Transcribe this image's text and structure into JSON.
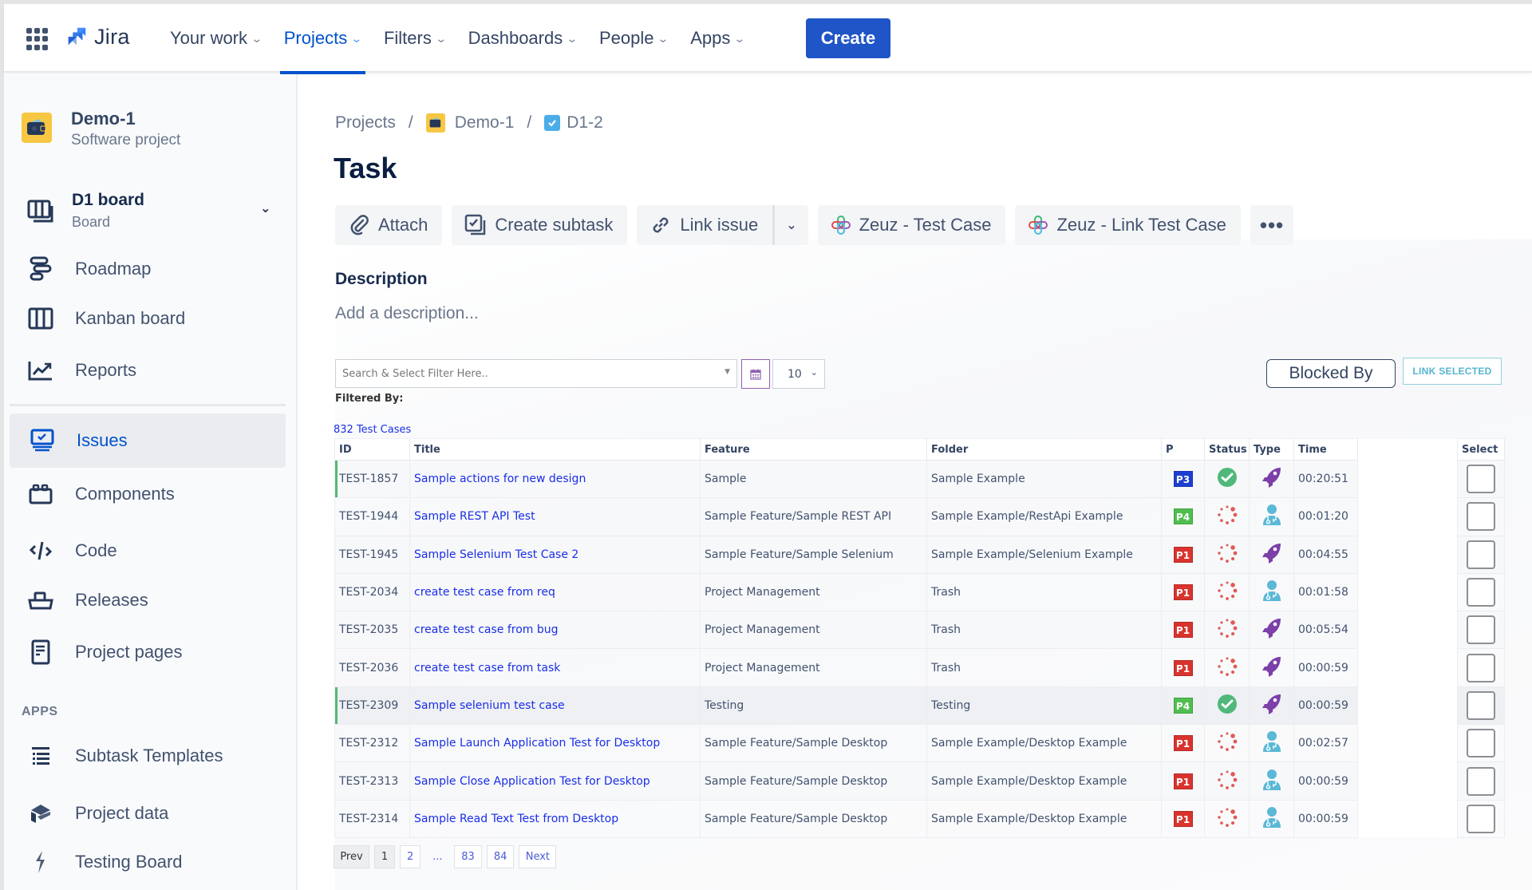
{
  "header": {
    "app_name": "Jira",
    "nav": [
      {
        "label": "Your work",
        "active": false
      },
      {
        "label": "Projects",
        "active": true
      },
      {
        "label": "Filters",
        "active": false
      },
      {
        "label": "Dashboards",
        "active": false
      },
      {
        "label": "People",
        "active": false
      },
      {
        "label": "Apps",
        "active": false
      }
    ],
    "create_label": "Create",
    "accent_color": "#0052cc"
  },
  "sidebar": {
    "project_name": "Demo-1",
    "project_type": "Software project",
    "board": {
      "label": "D1 board",
      "sub": "Board"
    },
    "items": [
      {
        "label": "Roadmap",
        "icon": "roadmap-icon"
      },
      {
        "label": "Kanban board",
        "icon": "kanban-icon"
      },
      {
        "label": "Reports",
        "icon": "reports-icon"
      },
      {
        "label": "Issues",
        "icon": "issues-icon",
        "active": true
      },
      {
        "label": "Components",
        "icon": "components-icon"
      },
      {
        "label": "Code",
        "icon": "code-icon"
      },
      {
        "label": "Releases",
        "icon": "releases-icon"
      },
      {
        "label": "Project pages",
        "icon": "project-pages-icon"
      }
    ],
    "apps_heading": "APPS",
    "apps": [
      {
        "label": "Subtask Templates",
        "icon": "list-icon"
      },
      {
        "label": "Project data",
        "icon": "project-data-icon"
      },
      {
        "label": "Testing Board",
        "icon": "lightning-icon"
      }
    ]
  },
  "breadcrumb": {
    "items": [
      "Projects",
      "Demo-1",
      "D1-2"
    ],
    "separator": "/"
  },
  "issue": {
    "type_title": "Task",
    "toolbar": {
      "attach": "Attach",
      "create_subtask": "Create subtask",
      "link_issue": "Link issue",
      "zeuz_test_case": "Zeuz - Test Case",
      "zeuz_link_test_case": "Zeuz - Link Test Case",
      "more": "•••"
    },
    "description_label": "Description",
    "description_placeholder": "Add a description..."
  },
  "test_cases": {
    "filter_placeholder": "Search & Select Filter Here..",
    "page_size": "10",
    "filtered_by_label": "Filtered By:",
    "count_label": "832 Test Cases",
    "blocked_by_label": "Blocked By",
    "link_selected_label": "LINK SELECTED",
    "columns": [
      "ID",
      "Title",
      "Feature",
      "Folder",
      "P",
      "Status",
      "Type",
      "Time",
      "Select"
    ],
    "rows": [
      {
        "id": "TEST-1857",
        "title": "Sample actions for new design",
        "feature": "Sample",
        "folder": "Sample Example",
        "priority": "P3",
        "status": "passed",
        "type": "automated",
        "time": "00:20:51",
        "marked": true
      },
      {
        "id": "TEST-1944",
        "title": "Sample REST API Test",
        "feature": "Sample Feature/Sample REST API",
        "folder": "Sample Example/RestApi Example",
        "priority": "P4",
        "status": "in-progress",
        "type": "manual",
        "time": "00:01:20"
      },
      {
        "id": "TEST-1945",
        "title": "Sample Selenium Test Case 2",
        "feature": "Sample Feature/Sample Selenium",
        "folder": "Sample Example/Selenium Example",
        "priority": "P1",
        "status": "in-progress",
        "type": "automated",
        "time": "00:04:55"
      },
      {
        "id": "TEST-2034",
        "title": "create test case from req",
        "feature": "Project Management",
        "folder": "Trash",
        "priority": "P1",
        "status": "in-progress",
        "type": "manual",
        "time": "00:01:58"
      },
      {
        "id": "TEST-2035",
        "title": "create test case from bug",
        "feature": "Project Management",
        "folder": "Trash",
        "priority": "P1",
        "status": "in-progress",
        "type": "automated",
        "time": "00:05:54"
      },
      {
        "id": "TEST-2036",
        "title": "create test case from task",
        "feature": "Project Management",
        "folder": "Trash",
        "priority": "P1",
        "status": "in-progress",
        "type": "automated",
        "time": "00:00:59"
      },
      {
        "id": "TEST-2309",
        "title": "Sample selenium test case",
        "feature": "Testing",
        "folder": "Testing",
        "priority": "P4",
        "status": "passed",
        "type": "automated",
        "time": "00:00:59",
        "marked": true,
        "highlight": true
      },
      {
        "id": "TEST-2312",
        "title": "Sample Launch Application Test for Desktop",
        "feature": "Sample Feature/Sample Desktop",
        "folder": "Sample Example/Desktop Example",
        "priority": "P1",
        "status": "in-progress",
        "type": "manual",
        "time": "00:02:57"
      },
      {
        "id": "TEST-2313",
        "title": "Sample Close Application Test for Desktop",
        "feature": "Sample Feature/Sample Desktop",
        "folder": "Sample Example/Desktop Example",
        "priority": "P1",
        "status": "in-progress",
        "type": "manual",
        "time": "00:00:59"
      },
      {
        "id": "TEST-2314",
        "title": "Sample Read Text Test from Desktop",
        "feature": "Sample Feature/Sample Desktop",
        "folder": "Sample Example/Desktop Example",
        "priority": "P1",
        "status": "in-progress",
        "type": "manual",
        "time": "00:00:59"
      }
    ],
    "priority_colors": {
      "P1": "#d9332d",
      "P3": "#1d3fd1",
      "P4": "#4fbe4f"
    },
    "status_colors": {
      "passed": "#4fb87a",
      "in-progress": "#e05a55"
    },
    "type_colors": {
      "automated": "#7d3fa8",
      "manual": "#5bb8d6"
    },
    "pagination": {
      "prev": "Prev",
      "pages": [
        "1",
        "2",
        "...",
        "83",
        "84"
      ],
      "current": "1",
      "next": "Next"
    }
  }
}
